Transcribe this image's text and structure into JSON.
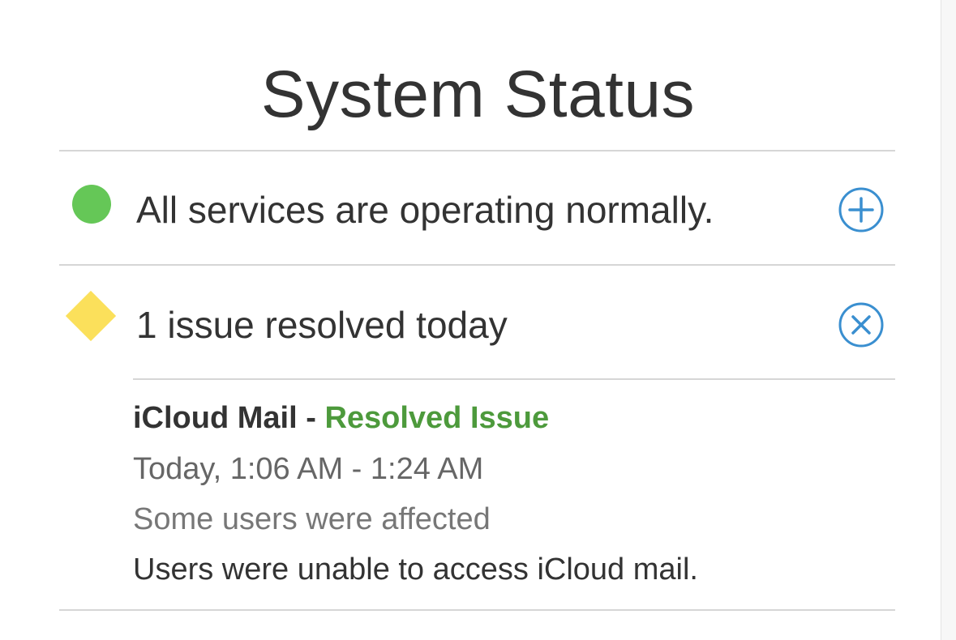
{
  "page": {
    "title": "System Status"
  },
  "rows": [
    {
      "status_icon": "green-dot-icon",
      "text": "All services are operating normally.",
      "action_icon": "plus-circle-icon",
      "color": "#65c757"
    },
    {
      "status_icon": "yellow-diamond-icon",
      "text": "1 issue resolved today",
      "action_icon": "close-circle-icon",
      "color": "#fbe05b"
    }
  ],
  "issue": {
    "service": "iCloud Mail",
    "separator": " - ",
    "state": "Resolved Issue",
    "time": "Today, 1:06 AM - 1:24 AM",
    "affected": "Some users were affected",
    "description": "Users were unable to access iCloud mail."
  },
  "colors": {
    "accent_blue": "#3a8fd0",
    "resolved_green": "#4d9a3c",
    "divider": "#d6d6d6"
  }
}
